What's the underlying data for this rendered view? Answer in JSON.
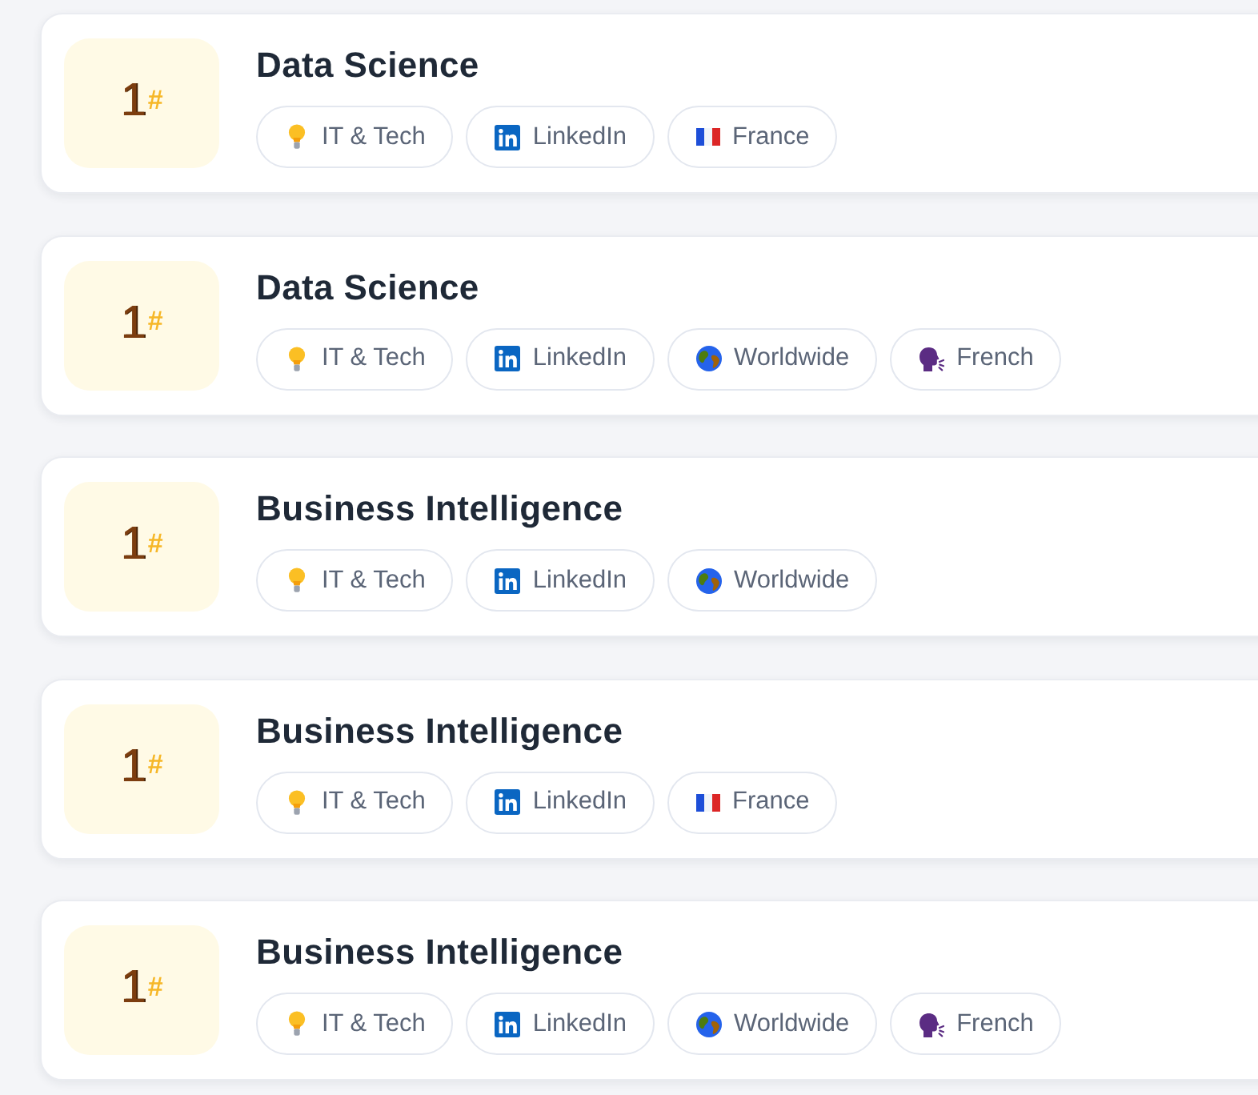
{
  "cards": [
    {
      "rank": "1",
      "rank_mark": "#",
      "title": "Data Science",
      "tags": [
        {
          "kind": "category",
          "label": "IT & Tech"
        },
        {
          "kind": "platform",
          "label": "LinkedIn"
        },
        {
          "kind": "country",
          "label": "France"
        }
      ]
    },
    {
      "rank": "1",
      "rank_mark": "#",
      "title": "Data Science",
      "tags": [
        {
          "kind": "category",
          "label": "IT & Tech"
        },
        {
          "kind": "platform",
          "label": "LinkedIn"
        },
        {
          "kind": "region",
          "label": "Worldwide"
        },
        {
          "kind": "language",
          "label": "French"
        }
      ]
    },
    {
      "rank": "1",
      "rank_mark": "#",
      "title": "Business Intelligence",
      "tags": [
        {
          "kind": "category",
          "label": "IT & Tech"
        },
        {
          "kind": "platform",
          "label": "LinkedIn"
        },
        {
          "kind": "region",
          "label": "Worldwide"
        }
      ]
    },
    {
      "rank": "1",
      "rank_mark": "#",
      "title": "Business Intelligence",
      "tags": [
        {
          "kind": "category",
          "label": "IT & Tech"
        },
        {
          "kind": "platform",
          "label": "LinkedIn"
        },
        {
          "kind": "country",
          "label": "France"
        }
      ]
    },
    {
      "rank": "1",
      "rank_mark": "#",
      "title": "Business Intelligence",
      "tags": [
        {
          "kind": "category",
          "label": "IT & Tech"
        },
        {
          "kind": "platform",
          "label": "LinkedIn"
        },
        {
          "kind": "region",
          "label": "Worldwide"
        },
        {
          "kind": "language",
          "label": "French"
        }
      ]
    }
  ]
}
